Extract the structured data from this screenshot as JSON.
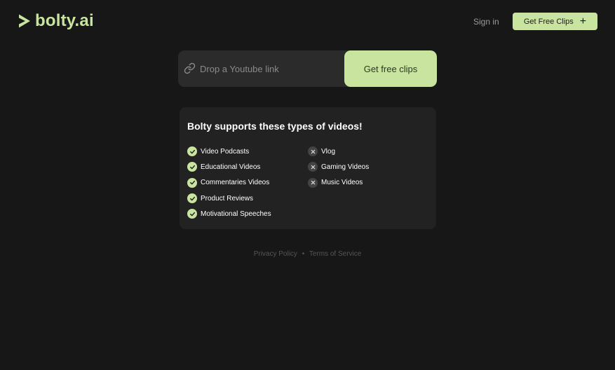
{
  "brand": {
    "name": "bolty.ai",
    "accent_color": "#c9e49f"
  },
  "header": {
    "signin_label": "Sign in",
    "cta_label": "Get Free Clips",
    "cta_icon": "plus-icon"
  },
  "url_form": {
    "placeholder": "Drop a Youtube link",
    "value": "",
    "icon": "link-icon",
    "submit_label": "Get free clips"
  },
  "supported": {
    "title": "Bolty supports these types of videos!",
    "supported_items": [
      {
        "label": "Video Podcasts",
        "icon": "check-icon"
      },
      {
        "label": "Educational Videos",
        "icon": "check-icon"
      },
      {
        "label": "Commentaries Videos",
        "icon": "check-icon"
      },
      {
        "label": "Product Reviews",
        "icon": "check-icon"
      },
      {
        "label": "Motivational Speeches",
        "icon": "check-icon"
      }
    ],
    "unsupported_items": [
      {
        "label": "Vlog",
        "icon": "x-icon"
      },
      {
        "label": "Gaming Videos",
        "icon": "x-icon"
      },
      {
        "label": "Music Videos",
        "icon": "x-icon"
      }
    ]
  },
  "footer": {
    "privacy_label": "Privacy Policy",
    "separator": "•",
    "terms_label": "Terms of Service"
  }
}
